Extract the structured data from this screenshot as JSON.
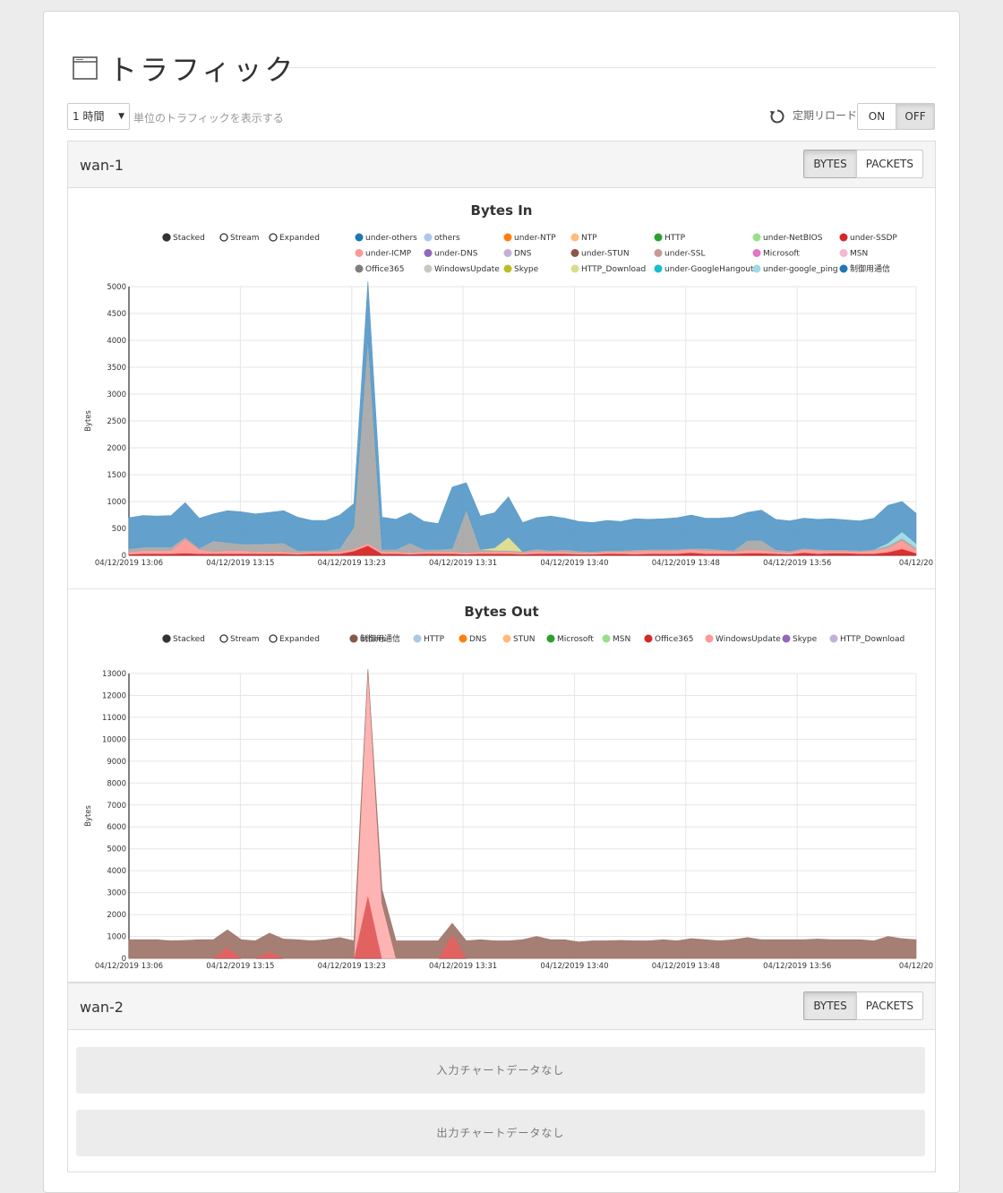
{
  "page": {
    "title": "トラフィック"
  },
  "toolbar": {
    "interval_value": "1 時間",
    "unit_label": "単位のトラフィックを表示する",
    "reload_label": "定期リロード",
    "on_label": "ON",
    "off_label": "OFF",
    "reload_state": "OFF"
  },
  "panels": [
    {
      "name": "wan-1",
      "bytes_label": "BYTES",
      "packets_label": "PACKETS",
      "active": "BYTES"
    },
    {
      "name": "wan-2",
      "bytes_label": "BYTES",
      "packets_label": "PACKETS",
      "active": "BYTES",
      "no_data_in": "入力チャートデータなし",
      "no_data_out": "出力チャートデータなし"
    }
  ],
  "controls": {
    "stacked": "Stacked",
    "stream": "Stream",
    "expanded": "Expanded",
    "selected": "Stacked"
  },
  "chart_data": [
    {
      "type": "area",
      "stacked": true,
      "title": "Bytes In",
      "ylabel": "Bytes",
      "xlabel": "",
      "ylim": [
        0,
        5000
      ],
      "yticks": [
        0,
        500,
        1000,
        1500,
        2000,
        2500,
        3000,
        3500,
        4000,
        4500,
        5000
      ],
      "xticks": [
        "04/12/2019 13:06",
        "04/12/2019 13:15",
        "04/12/2019 13:23",
        "04/12/2019 13:31",
        "04/12/2019 13:40",
        "04/12/2019 13:48",
        "04/12/2019 13:56",
        "04/12/20"
      ],
      "legend_position": "top",
      "legend": [
        {
          "name": "under-others",
          "color": "#1f77b4"
        },
        {
          "name": "others",
          "color": "#aec7e8"
        },
        {
          "name": "under-NTP",
          "color": "#ff7f0e"
        },
        {
          "name": "NTP",
          "color": "#ffbb78"
        },
        {
          "name": "HTTP",
          "color": "#2ca02c"
        },
        {
          "name": "under-NetBIOS",
          "color": "#98df8a"
        },
        {
          "name": "under-SSDP",
          "color": "#d62728"
        },
        {
          "name": "under-ICMP",
          "color": "#ff9896"
        },
        {
          "name": "under-DNS",
          "color": "#9467bd"
        },
        {
          "name": "DNS",
          "color": "#c5b0d5"
        },
        {
          "name": "under-STUN",
          "color": "#8c564b"
        },
        {
          "name": "under-SSL",
          "color": "#c49c94"
        },
        {
          "name": "Microsoft",
          "color": "#e377c2"
        },
        {
          "name": "MSN",
          "color": "#f7b6d2"
        },
        {
          "name": "Office365",
          "color": "#7f7f7f"
        },
        {
          "name": "WindowsUpdate",
          "color": "#c7c7c7"
        },
        {
          "name": "Skype",
          "color": "#bcbd22"
        },
        {
          "name": "HTTP_Download",
          "color": "#dbdb8d"
        },
        {
          "name": "under-GoogleHangout",
          "color": "#17becf"
        },
        {
          "name": "under-google_ping",
          "color": "#9edae5"
        },
        {
          "name": "制御用通信",
          "color": "#1f77b4"
        }
      ],
      "series": [
        {
          "name": "under-SSDP",
          "color": "#d62728",
          "values": [
            20,
            30,
            30,
            30,
            40,
            30,
            30,
            30,
            30,
            30,
            30,
            30,
            20,
            30,
            30,
            30,
            80,
            180,
            30,
            30,
            20,
            30,
            30,
            30,
            20,
            30,
            30,
            30,
            20,
            30,
            30,
            30,
            20,
            20,
            30,
            30,
            20,
            30,
            30,
            30,
            50,
            30,
            30,
            30,
            40,
            40,
            30,
            20,
            50,
            30,
            40,
            40,
            30,
            30,
            60,
            120,
            40
          ]
        },
        {
          "name": "under-ICMP",
          "color": "#ff9896",
          "values": [
            40,
            60,
            60,
            60,
            260,
            80,
            40,
            60,
            60,
            40,
            40,
            40,
            30,
            40,
            40,
            40,
            40,
            40,
            40,
            40,
            30,
            40,
            40,
            40,
            30,
            40,
            40,
            40,
            30,
            50,
            40,
            40,
            30,
            30,
            40,
            40,
            60,
            60,
            60,
            60,
            60,
            60,
            60,
            40,
            60,
            60,
            40,
            40,
            60,
            60,
            40,
            40,
            40,
            60,
            80,
            160,
            60
          ]
        },
        {
          "name": "WindowsUpdate",
          "color": "#a9a9a9",
          "values": [
            60,
            60,
            60,
            60,
            40,
            20,
            200,
            150,
            120,
            140,
            150,
            160,
            40,
            20,
            20,
            60,
            400,
            3800,
            40,
            40,
            180,
            40,
            40,
            60,
            800,
            40,
            20,
            20,
            20,
            40,
            20,
            40,
            30,
            20,
            20,
            20,
            20,
            20,
            20,
            20,
            20,
            40,
            20,
            20,
            180,
            180,
            40,
            20,
            20,
            20,
            20,
            20,
            20,
            20,
            40,
            40,
            40
          ]
        },
        {
          "name": "HTTP_Download",
          "color": "#dbdb8d",
          "values": [
            0,
            0,
            0,
            0,
            0,
            0,
            0,
            0,
            0,
            0,
            0,
            0,
            0,
            0,
            0,
            0,
            0,
            0,
            0,
            0,
            0,
            0,
            0,
            0,
            0,
            0,
            50,
            250,
            0,
            0,
            0,
            0,
            0,
            0,
            0,
            0,
            0,
            0,
            0,
            0,
            0,
            0,
            0,
            0,
            0,
            0,
            0,
            0,
            0,
            0,
            0,
            0,
            0,
            0,
            0,
            0,
            0
          ]
        },
        {
          "name": "under-google_ping",
          "color": "#9edae5",
          "values": [
            0,
            0,
            0,
            0,
            0,
            0,
            0,
            0,
            0,
            0,
            0,
            0,
            0,
            0,
            0,
            0,
            0,
            0,
            0,
            0,
            0,
            0,
            0,
            0,
            0,
            0,
            0,
            0,
            0,
            0,
            0,
            0,
            0,
            0,
            0,
            0,
            0,
            0,
            0,
            0,
            0,
            0,
            0,
            0,
            0,
            0,
            0,
            0,
            0,
            0,
            0,
            0,
            0,
            0,
            50,
            120,
            80
          ]
        },
        {
          "name": "under-others",
          "color": "#5b9bc9",
          "values": [
            580,
            590,
            580,
            590,
            640,
            560,
            500,
            590,
            600,
            560,
            580,
            600,
            620,
            560,
            560,
            620,
            440,
            1080,
            600,
            560,
            560,
            520,
            480,
            1140,
            500,
            620,
            650,
            750,
            540,
            580,
            640,
            580,
            550,
            540,
            560,
            540,
            580,
            560,
            570,
            590,
            620,
            560,
            580,
            620,
            520,
            560,
            560,
            560,
            560,
            560,
            580,
            560,
            550,
            580,
            700,
            560,
            560
          ]
        }
      ]
    },
    {
      "type": "area",
      "stacked": true,
      "title": "Bytes Out",
      "ylabel": "Bytes",
      "xlabel": "",
      "ylim": [
        0,
        13000
      ],
      "yticks": [
        0,
        1000,
        2000,
        3000,
        4000,
        5000,
        6000,
        7000,
        8000,
        9000,
        10000,
        11000,
        12000,
        13000
      ],
      "xticks": [
        "04/12/2019 13:06",
        "04/12/2019 13:15",
        "04/12/2019 13:23",
        "04/12/2019 13:31",
        "04/12/2019 13:40",
        "04/12/2019 13:48",
        "04/12/2019 13:56",
        "04/12/20"
      ],
      "legend_position": "top",
      "legend": [
        {
          "name": "others",
          "color": "#1f77b4"
        },
        {
          "name": "HTTP",
          "color": "#aec7e8"
        },
        {
          "name": "DNS",
          "color": "#ff7f0e"
        },
        {
          "name": "STUN",
          "color": "#ffbb78"
        },
        {
          "name": "Microsoft",
          "color": "#2ca02c"
        },
        {
          "name": "MSN",
          "color": "#98df8a"
        },
        {
          "name": "Office365",
          "color": "#d62728"
        },
        {
          "name": "WindowsUpdate",
          "color": "#ff9896"
        },
        {
          "name": "Skype",
          "color": "#9467bd"
        },
        {
          "name": "HTTP_Download",
          "color": "#c5b0d5"
        },
        {
          "name": "制御用通信",
          "color": "#8c564b"
        }
      ],
      "series": [
        {
          "name": "Office365",
          "color": "#e05a5a",
          "values": [
            0,
            0,
            0,
            0,
            0,
            0,
            0,
            500,
            0,
            0,
            300,
            0,
            0,
            0,
            0,
            0,
            0,
            2900,
            0,
            0,
            0,
            0,
            0,
            1100,
            0,
            0,
            0,
            0,
            0,
            0,
            0,
            0,
            0,
            0,
            0,
            0,
            0,
            0,
            0,
            0,
            0,
            0,
            0,
            0,
            0,
            0,
            0,
            0,
            0,
            0,
            0,
            0,
            0,
            0,
            0,
            0,
            0
          ]
        },
        {
          "name": "WindowsUpdate",
          "color": "#ffb0b0",
          "values": [
            0,
            0,
            0,
            0,
            0,
            0,
            0,
            0,
            0,
            0,
            0,
            0,
            0,
            0,
            0,
            0,
            0,
            10300,
            2500,
            0,
            0,
            0,
            0,
            0,
            0,
            0,
            0,
            0,
            0,
            0,
            0,
            0,
            0,
            0,
            0,
            0,
            0,
            0,
            0,
            0,
            0,
            0,
            0,
            0,
            0,
            0,
            0,
            0,
            0,
            0,
            0,
            0,
            0,
            0,
            0,
            0,
            0
          ]
        },
        {
          "name": "制御用通信",
          "color": "#a0776d",
          "values": [
            850,
            850,
            850,
            800,
            820,
            850,
            850,
            800,
            850,
            800,
            850,
            880,
            850,
            800,
            850,
            950,
            800,
            0,
            650,
            800,
            800,
            800,
            800,
            500,
            800,
            850,
            800,
            800,
            850,
            1000,
            850,
            850,
            750,
            800,
            800,
            820,
            800,
            800,
            850,
            800,
            900,
            850,
            800,
            850,
            950,
            850,
            850,
            850,
            850,
            880,
            850,
            850,
            850,
            800,
            1000,
            900,
            850
          ]
        }
      ]
    }
  ]
}
